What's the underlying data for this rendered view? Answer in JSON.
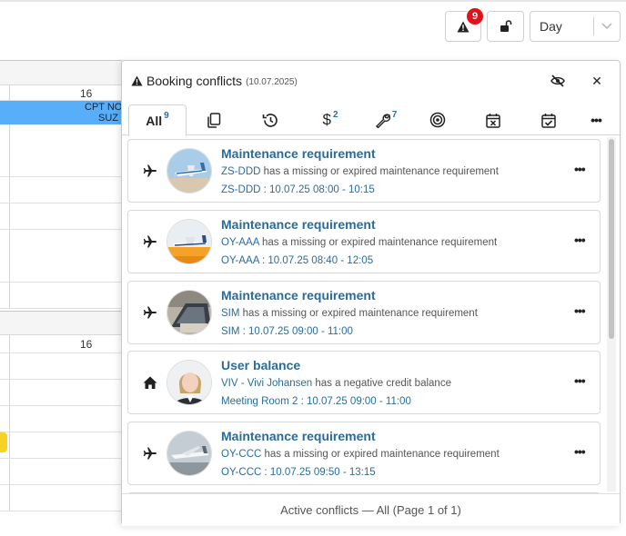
{
  "toolbar": {
    "alert_count": "9",
    "view_select": "Day"
  },
  "background": {
    "day_number_top": "16",
    "day_number_bottom": "16",
    "booking_line1": "CPT NO",
    "booking_line2": "SUZ"
  },
  "panel": {
    "title": "Booking conflicts",
    "date": "(10.07.2025)",
    "tabs": [
      {
        "label": "All",
        "count": "9",
        "icon": "all"
      },
      {
        "label": "",
        "count": "",
        "icon": "copy-icon"
      },
      {
        "label": "",
        "count": "",
        "icon": "history-icon"
      },
      {
        "label": "",
        "count": "2",
        "icon": "dollar-icon"
      },
      {
        "label": "",
        "count": "7",
        "icon": "wrench-icon"
      },
      {
        "label": "",
        "count": "",
        "icon": "target-icon"
      },
      {
        "label": "",
        "count": "",
        "icon": "calendar-x-icon"
      },
      {
        "label": "",
        "count": "",
        "icon": "calendar-check-icon"
      },
      {
        "label": "",
        "count": "",
        "icon": "more-icon"
      }
    ],
    "items": [
      {
        "type_icon": "plane-icon",
        "title": "Maintenance requirement",
        "subject": "ZS-DDD",
        "message": "has a missing or expired maintenance requirement",
        "when": "ZS-DDD : 10.07.25 08:00 - 10:15"
      },
      {
        "type_icon": "plane-icon",
        "title": "Maintenance requirement",
        "subject": "OY-AAA",
        "message": "has a missing or expired maintenance requirement",
        "when": "OY-AAA : 10.07.25 08:40 - 12:05"
      },
      {
        "type_icon": "plane-icon",
        "title": "Maintenance requirement",
        "subject": "SIM",
        "message": "has a missing or expired maintenance requirement",
        "when": "SIM : 10.07.25 09:00 - 11:00"
      },
      {
        "type_icon": "home-icon",
        "title": "User balance",
        "subject": "VIV - Vivi Johansen",
        "message": "has a negative credit balance",
        "when": "Meeting Room 2 : 10.07.25 09:00 - 11:00"
      },
      {
        "type_icon": "plane-icon",
        "title": "Maintenance requirement",
        "subject": "OY-CCC",
        "message": "has a missing or expired maintenance requirement",
        "when": "OY-CCC : 10.07.25 09:50 - 13:15"
      }
    ],
    "footer": "Active conflicts — All (Page 1 of 1)"
  },
  "colors": {
    "accent_link": "#2b6c97",
    "alert_badge": "#e0131b",
    "booking_bar": "#58aef8"
  }
}
